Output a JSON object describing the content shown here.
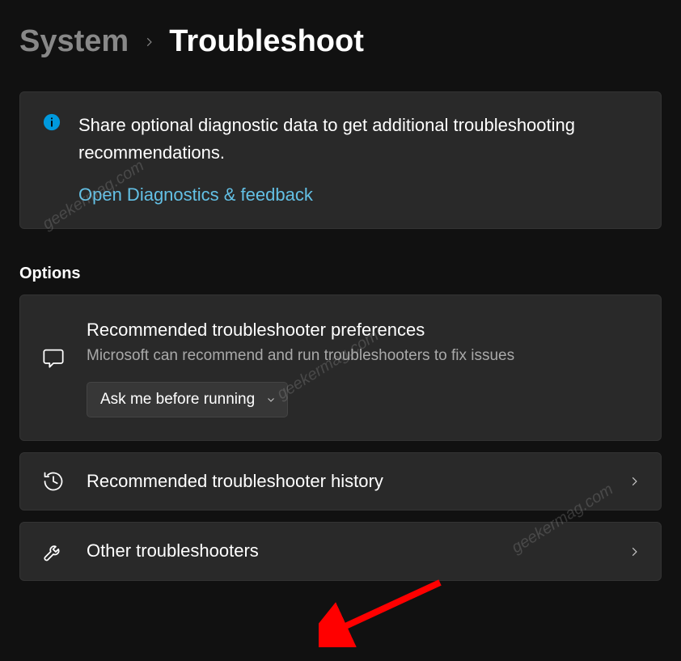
{
  "breadcrumb": {
    "parent": "System",
    "title": "Troubleshoot"
  },
  "info": {
    "text": "Share optional diagnostic data to get additional troubleshooting recommendations.",
    "link_label": "Open Diagnostics & feedback"
  },
  "section_heading": "Options",
  "preferences": {
    "title": "Recommended troubleshooter preferences",
    "subtitle": "Microsoft can recommend and run troubleshooters to fix issues",
    "dropdown_value": "Ask me before running"
  },
  "history": {
    "title": "Recommended troubleshooter history"
  },
  "other": {
    "title": "Other troubleshooters"
  },
  "watermark_text": "geekermag.com"
}
